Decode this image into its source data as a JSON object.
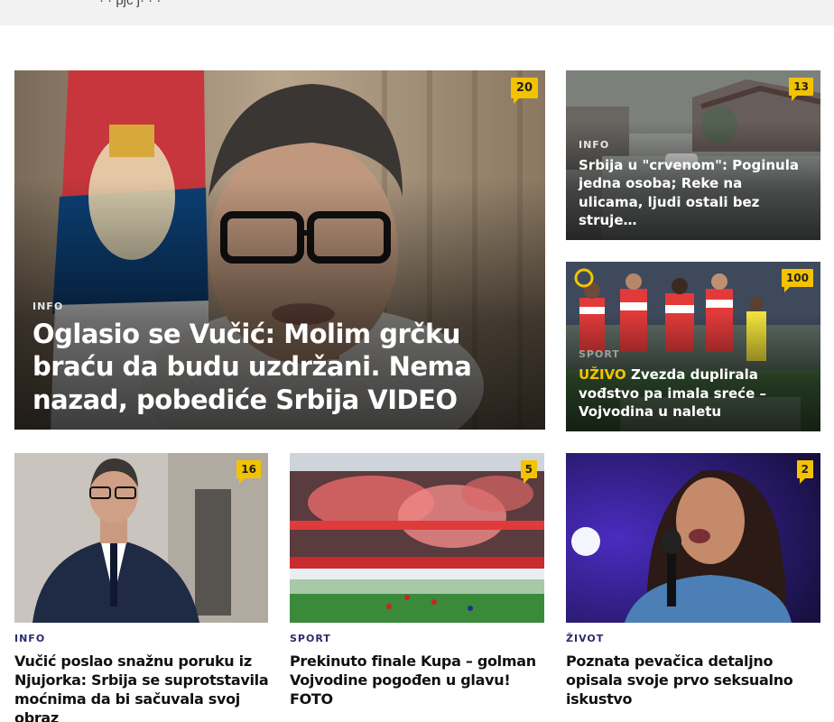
{
  "topbar": {
    "text": "· · pjc j· · ·"
  },
  "hero": {
    "comments": "20",
    "category": "INFO",
    "title": "Oglasio se Vučić: Molim grčku braću da budu uzdržani. Nema nazad, pobediće Srbija VIDEO"
  },
  "side_top": {
    "comments": "13",
    "category": "INFO",
    "title": "Srbija u \"crvenom\": Poginula jedna osoba; Reke na ulicama, ljudi ostali bez struje…"
  },
  "side_bottom": {
    "comments": "100",
    "category": "SPORT",
    "live_label": "UŽIVO",
    "title": "Zvezda duplirala vođstvo pa imala sreće – Vojvodina u naletu"
  },
  "cards": [
    {
      "comments": "16",
      "category": "INFO",
      "title": "Vučić poslao snažnu poruku iz Njujorka: Srbija se suprotstavila moćnima da bi sačuvala svoj obraz"
    },
    {
      "comments": "5",
      "category": "SPORT",
      "title": "Prekinuto finale Kupa – golman Vojvodine pogođen u glavu! FOTO"
    },
    {
      "comments": "2",
      "category": "ŽIVOT",
      "title": "Poznata pevačica detaljno opisala svoje prvo seksualno iskustvo"
    }
  ],
  "colors": {
    "badge": "#f3c300",
    "category_dark": "#2b2b6e",
    "live": "#f3c300",
    "topbar": "#f2f2f2"
  },
  "icons": [
    "comment-badge-icon"
  ]
}
